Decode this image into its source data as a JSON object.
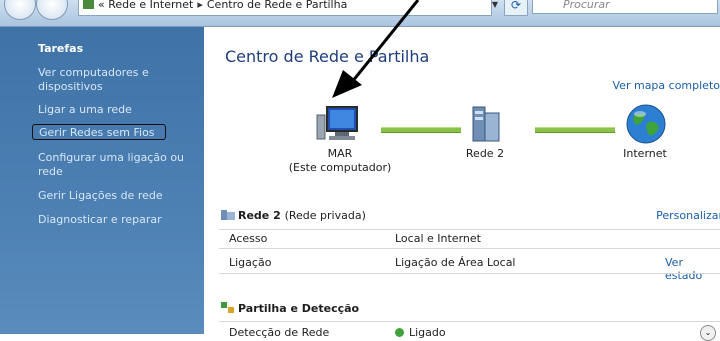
{
  "address_bar": {
    "breadcrumb_prefix": "«",
    "breadcrumb_1": "Rede e Internet",
    "breadcrumb_sep": "▸",
    "breadcrumb_2": "Centro de Rede e Partilha",
    "search_placeholder": "Procurar"
  },
  "sidebar": {
    "title": "Tarefas",
    "items": [
      {
        "label": "Ver computadores e dispositivos"
      },
      {
        "label": "Ligar a uma rede"
      },
      {
        "label": "Gerir Redes sem Fios"
      },
      {
        "label": "Configurar uma ligação ou rede"
      },
      {
        "label": "Gerir Ligações de rede"
      },
      {
        "label": "Diagnosticar e reparar"
      }
    ]
  },
  "main": {
    "title": "Centro de Rede e Partilha",
    "map_link": "Ver mapa completo",
    "nodes": {
      "computer_name": "MAR",
      "computer_sub": "(Este computador)",
      "network": "Rede  2",
      "internet": "Internet"
    },
    "network_section": {
      "name": "Rede  2",
      "type": "(Rede privada)",
      "customize": "Personalizar",
      "rows": [
        {
          "label": "Acesso",
          "value": "Local e Internet",
          "action": ""
        },
        {
          "label": "Ligação",
          "value": "Ligação de Área Local",
          "action": "Ver estado"
        }
      ]
    },
    "sharing_section": {
      "title": "Partilha e Detecção",
      "rows": [
        {
          "label": "Detecção de Rede",
          "value": "Ligado"
        }
      ]
    }
  },
  "colors": {
    "sidebar": "#4a7db0",
    "link": "#1a5fa8",
    "title": "#1e3d7b"
  }
}
